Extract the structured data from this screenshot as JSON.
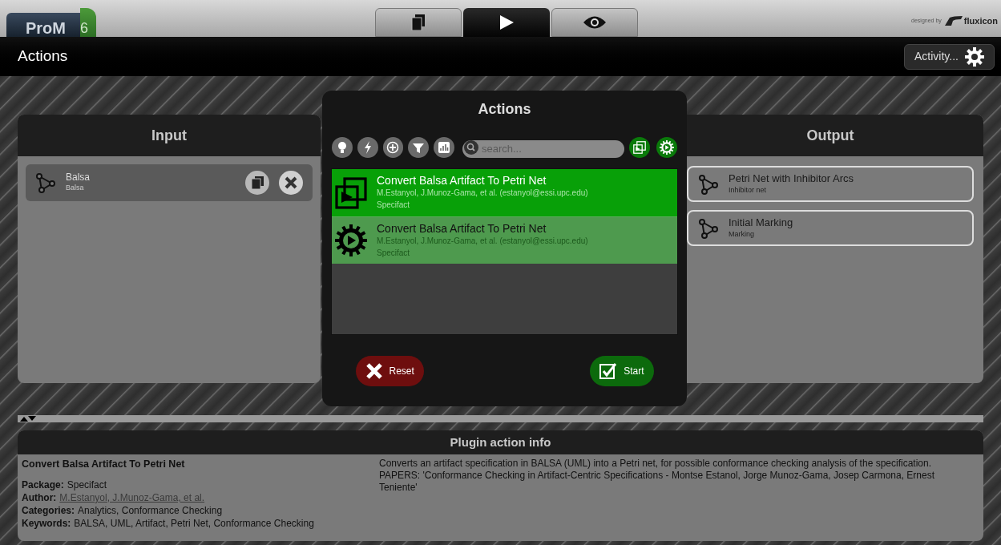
{
  "logo": {
    "name": "ProM",
    "version": "6"
  },
  "view_tabs": [
    {
      "kind": "workspace",
      "selected": false
    },
    {
      "kind": "actions",
      "selected": true
    },
    {
      "kind": "view",
      "selected": false
    }
  ],
  "credit": {
    "prefix": "designed by",
    "brand": "fluxicon"
  },
  "title_bar": {
    "title": "Actions",
    "activity_button": "Activity..."
  },
  "input": {
    "title": "Input",
    "items": [
      {
        "name": "Balsa",
        "type": "Balsa"
      }
    ]
  },
  "output": {
    "title": "Output",
    "items": [
      {
        "name": "Petri Net with Inhibitor Arcs",
        "type": "Inhibitor net"
      },
      {
        "name": "Initial Marking",
        "type": "Marking"
      }
    ]
  },
  "dialog": {
    "title": "Actions",
    "filters": [
      {
        "kind": "bulb"
      },
      {
        "kind": "bolt"
      },
      {
        "kind": "plus"
      },
      {
        "kind": "funnel"
      },
      {
        "kind": "chart"
      }
    ],
    "search": {
      "placeholder": "search..."
    },
    "toggles": [
      {
        "kind": "stack",
        "on": true
      },
      {
        "kind": "gear",
        "on": true
      }
    ],
    "plugins": [
      {
        "kind": "stack",
        "selected": true,
        "name": "Convert Balsa Artifact To Petri Net",
        "authors": "M.Estanyol, J.Munoz-Gama, et al. (estanyol@essi.upc.edu)",
        "package": "Specifact"
      },
      {
        "kind": "gear",
        "selected": false,
        "name": "Convert Balsa Artifact To Petri Net",
        "authors": "M.Estanyol, J.Munoz-Gama, et al. (estanyol@essi.upc.edu)",
        "package": "Specifact"
      }
    ],
    "reset_button": "Reset",
    "start_button": "Start"
  },
  "info": {
    "title": "Plugin action info",
    "plugin_name": "Convert Balsa Artifact To Petri Net",
    "fields": [
      {
        "label": "Package:",
        "value": "Specifact",
        "kind": "text"
      },
      {
        "label": "Author:",
        "value": "M.Estanyol, J.Munoz-Gama, et al.",
        "kind": "link"
      },
      {
        "label": "Categories:",
        "value": "Analytics, Conformance Checking",
        "kind": "text"
      },
      {
        "label": "Keywords:",
        "value": "BALSA, UML, Artifact, Petri Net, Conformance Checking",
        "kind": "text"
      }
    ],
    "description": "Converts an artifact specification in BALSA (UML) into a Petri net, for possible conformance checking analysis of the specification. PAPERS: 'Conformance Checking in Artifact-Centric Specifications - Montse Estanol, Jorge Munoz-Gama, Josep Carmona, Ernest Teniente'"
  }
}
